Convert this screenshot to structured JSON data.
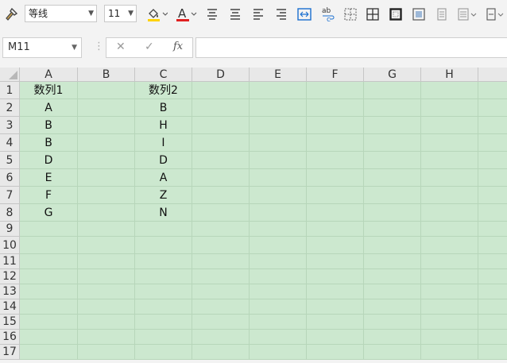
{
  "toolbar": {
    "font_name": "等线",
    "font_size": "11",
    "font_color_letter": "A",
    "font_color": "#e02020",
    "icons": [
      "format-painter-icon",
      "fill-color-icon",
      "font-color-icon",
      "align-top-icon",
      "align-middle-icon",
      "align-left-icon",
      "align-right-icon",
      "merge-center-icon",
      "wrap-text-icon",
      "borders-icon",
      "all-borders-icon",
      "thick-border-icon",
      "text-box-icon",
      "freeze-icon",
      "insert-icon",
      "more-icon"
    ]
  },
  "formula_bar": {
    "name_box": "M11",
    "cancel_symbol": "✕",
    "confirm_symbol": "✓",
    "fx_label": "fx",
    "content": ""
  },
  "sheet": {
    "columns": [
      "A",
      "B",
      "C",
      "D",
      "E",
      "F",
      "G",
      "H",
      ""
    ],
    "rows": [
      {
        "num": "1",
        "cells": [
          "数列1",
          "",
          "数列2",
          "",
          "",
          "",
          "",
          "",
          ""
        ]
      },
      {
        "num": "2",
        "cells": [
          "A",
          "",
          "B",
          "",
          "",
          "",
          "",
          "",
          ""
        ]
      },
      {
        "num": "3",
        "cells": [
          "B",
          "",
          "H",
          "",
          "",
          "",
          "",
          "",
          ""
        ]
      },
      {
        "num": "4",
        "cells": [
          "B",
          "",
          "I",
          "",
          "",
          "",
          "",
          "",
          ""
        ]
      },
      {
        "num": "5",
        "cells": [
          "D",
          "",
          "D",
          "",
          "",
          "",
          "",
          "",
          ""
        ]
      },
      {
        "num": "6",
        "cells": [
          "E",
          "",
          "A",
          "",
          "",
          "",
          "",
          "",
          ""
        ]
      },
      {
        "num": "7",
        "cells": [
          "F",
          "",
          "Z",
          "",
          "",
          "",
          "",
          "",
          ""
        ]
      },
      {
        "num": "8",
        "cells": [
          "G",
          "",
          "N",
          "",
          "",
          "",
          "",
          "",
          ""
        ]
      },
      {
        "num": "9",
        "cells": [
          "",
          "",
          "",
          "",
          "",
          "",
          "",
          "",
          ""
        ]
      },
      {
        "num": "10",
        "cells": [
          "",
          "",
          "",
          "",
          "",
          "",
          "",
          "",
          ""
        ]
      },
      {
        "num": "11",
        "cells": [
          "",
          "",
          "",
          "",
          "",
          "",
          "",
          "",
          ""
        ]
      },
      {
        "num": "12",
        "cells": [
          "",
          "",
          "",
          "",
          "",
          "",
          "",
          "",
          ""
        ]
      },
      {
        "num": "13",
        "cells": [
          "",
          "",
          "",
          "",
          "",
          "",
          "",
          "",
          ""
        ]
      },
      {
        "num": "14",
        "cells": [
          "",
          "",
          "",
          "",
          "",
          "",
          "",
          "",
          ""
        ]
      },
      {
        "num": "15",
        "cells": [
          "",
          "",
          "",
          "",
          "",
          "",
          "",
          "",
          ""
        ]
      },
      {
        "num": "16",
        "cells": [
          "",
          "",
          "",
          "",
          "",
          "",
          "",
          "",
          ""
        ]
      },
      {
        "num": "17",
        "cells": [
          "",
          "",
          "",
          "",
          "",
          "",
          "",
          "",
          ""
        ]
      }
    ],
    "cell_background": "#cce8cf"
  }
}
